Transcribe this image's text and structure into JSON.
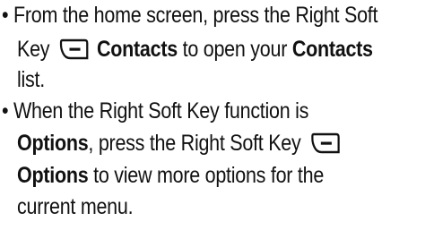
{
  "document": {
    "bullet_glyph": "•",
    "items": [
      {
        "line1_pre": "From the home screen, press the Right Soft",
        "line2_key": "Key",
        "line2_bold": "Contacts",
        "line2_mid": "to open your",
        "line2_bold2": "Contacts",
        "line3": "list."
      },
      {
        "line1": "When the Right Soft Key function is",
        "line2_bold": "Options",
        "line2_rest": ", press the Right Soft Key",
        "line3_bold": "Options",
        "line3_rest": "to view more options for the",
        "line4": "current menu."
      }
    ],
    "icons": {
      "right_soft_key": "right-soft-key-icon"
    }
  }
}
